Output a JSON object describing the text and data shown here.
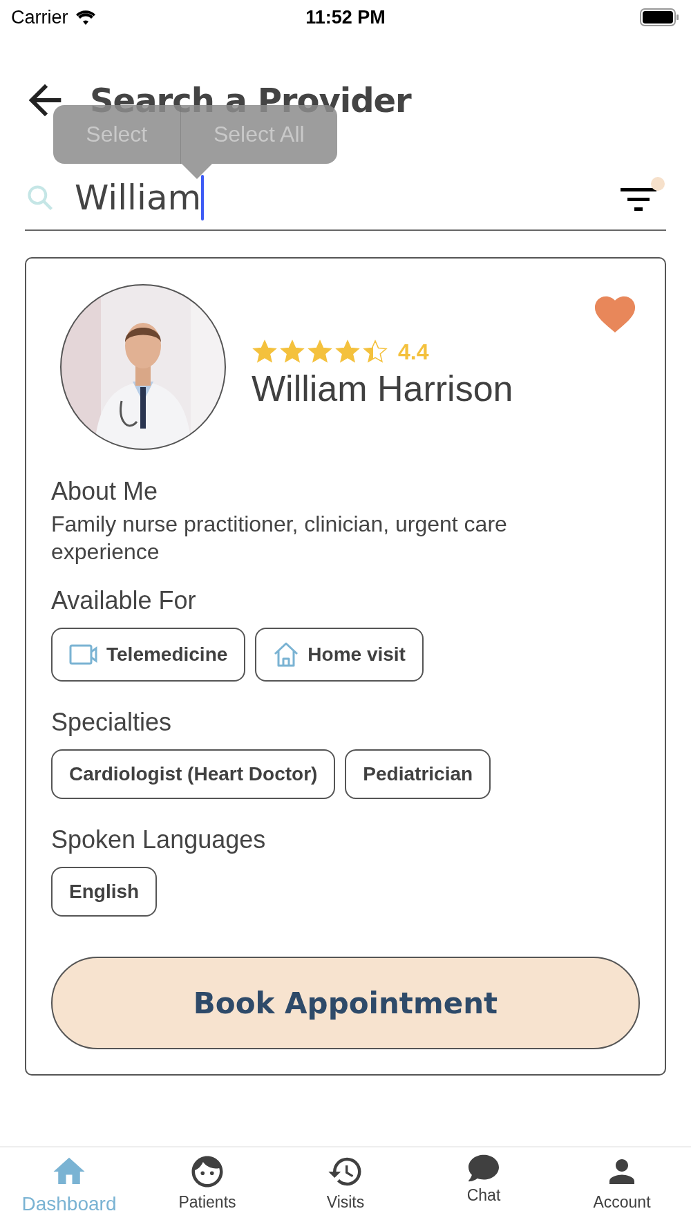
{
  "status_bar": {
    "carrier": "Carrier",
    "time": "11:52 PM"
  },
  "header": {
    "title": "Search a Provider"
  },
  "edit_menu": {
    "items": [
      "Select",
      "Select All"
    ]
  },
  "search": {
    "value": "William"
  },
  "provider": {
    "name": "William Harrison",
    "rating": "4.4",
    "stars": 4.4,
    "favorite": true,
    "about_title": "About Me",
    "about": "Family nurse practitioner, clinician, urgent care experience",
    "available_title": "Available For",
    "available": [
      "Telemedicine",
      "Home visit"
    ],
    "specialties_title": "Specialties",
    "specialties": [
      "Cardiologist (Heart Doctor)",
      "Pediatrician"
    ],
    "languages_title": "Spoken Languages",
    "languages": [
      "English"
    ],
    "book_button": "Book Appointment"
  },
  "tab_bar": [
    {
      "label": "Dashboard",
      "selected": true
    },
    {
      "label": "Patients",
      "selected": false
    },
    {
      "label": "Visits",
      "selected": false
    },
    {
      "label": "Chat",
      "selected": false
    },
    {
      "label": "Account",
      "selected": false
    }
  ]
}
